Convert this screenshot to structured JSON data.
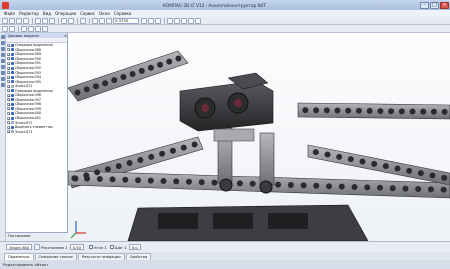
{
  "window": {
    "title": "КОМПАС-3D LT V12 - Аналоги/конструктор NXT",
    "minimize": "–",
    "maximize": "□",
    "close": "×"
  },
  "menu": [
    "Файл",
    "Редактор",
    "Вид",
    "Операции",
    "Сервис",
    "Окно",
    "Справка"
  ],
  "toolbar": {
    "zoom_value": "0.3750"
  },
  "tree": {
    "title": "Дерево модели",
    "items": [
      {
        "label": "Операция выделения",
        "type": "op"
      },
      {
        "label": "Сборочная:388",
        "type": "part"
      },
      {
        "label": "Сборочная:389",
        "type": "part"
      },
      {
        "label": "Сборочная:390",
        "type": "part"
      },
      {
        "label": "Сборочная:391",
        "type": "part"
      },
      {
        "label": "Сборочная:392",
        "type": "part"
      },
      {
        "label": "Сборочная:393",
        "type": "part"
      },
      {
        "label": "Сборочная:394",
        "type": "part"
      },
      {
        "label": "Сборочная:395",
        "type": "part"
      },
      {
        "label": "Эскиз:871",
        "type": "flat"
      },
      {
        "label": "Операция выделения",
        "type": "op"
      },
      {
        "label": "Сборочная:396",
        "type": "part"
      },
      {
        "label": "Сборочная:397",
        "type": "part"
      },
      {
        "label": "Сборочная:398",
        "type": "part"
      },
      {
        "label": "Сборочная:399",
        "type": "part"
      },
      {
        "label": "Сборочная:400",
        "type": "part"
      },
      {
        "label": "Сборочная:401",
        "type": "part"
      },
      {
        "label": "Эскиз:872",
        "type": "flat"
      },
      {
        "label": "Вырезать элемент вы",
        "type": "op"
      },
      {
        "label": "Эскиз:873",
        "type": "flat"
      }
    ],
    "bottom_label": "Построение"
  },
  "propbar": {
    "object": "Эскиз:384",
    "distance_label": "Расстояние 1",
    "distance_value": "0.50",
    "angle_label": "Угол 1",
    "step_label": "Шаг 1",
    "step_value": "0.0"
  },
  "tabs": [
    "Параметры",
    "Смещение тонких",
    "Результат операции",
    "Свойства"
  ],
  "status": "Редактировать объект",
  "colors": {
    "accent": "#2f63c4",
    "brick": "#8f9196",
    "dark": "#3a3b3e"
  }
}
